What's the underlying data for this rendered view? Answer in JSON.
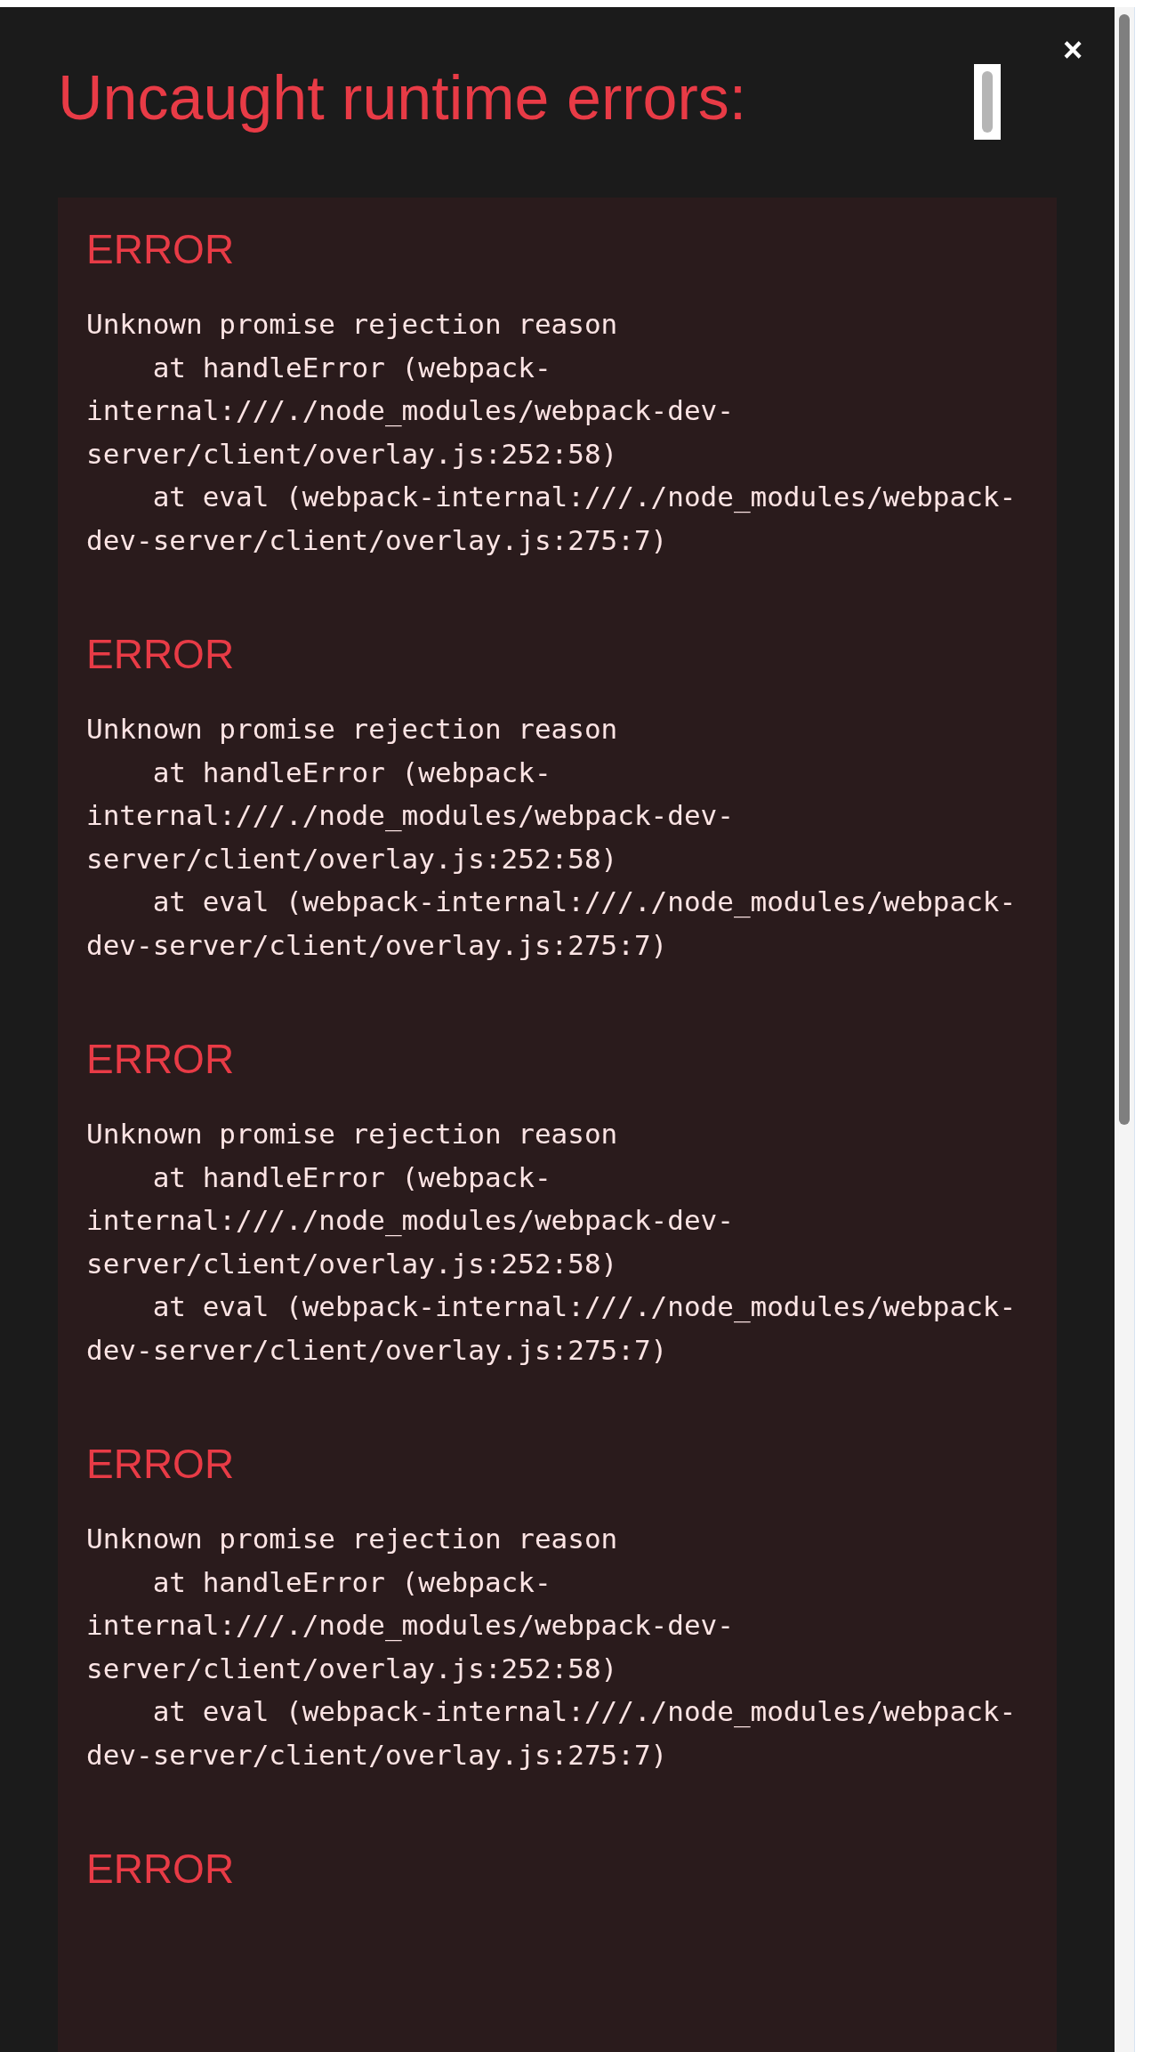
{
  "overlay": {
    "title": "Uncaught runtime errors:",
    "close": "×"
  },
  "errors": [
    {
      "title": "ERROR",
      "message": "Unknown promise rejection reason\n    at handleError (webpack-internal:///./node_modules/webpack-dev-server/client/overlay.js:252:58)\n    at eval (webpack-internal:///./node_modules/webpack-dev-server/client/overlay.js:275:7)"
    },
    {
      "title": "ERROR",
      "message": "Unknown promise rejection reason\n    at handleError (webpack-internal:///./node_modules/webpack-dev-server/client/overlay.js:252:58)\n    at eval (webpack-internal:///./node_modules/webpack-dev-server/client/overlay.js:275:7)"
    },
    {
      "title": "ERROR",
      "message": "Unknown promise rejection reason\n    at handleError (webpack-internal:///./node_modules/webpack-dev-server/client/overlay.js:252:58)\n    at eval (webpack-internal:///./node_modules/webpack-dev-server/client/overlay.js:275:7)"
    },
    {
      "title": "ERROR",
      "message": "Unknown promise rejection reason\n    at handleError (webpack-internal:///./node_modules/webpack-dev-server/client/overlay.js:252:58)\n    at eval (webpack-internal:///./node_modules/webpack-dev-server/client/overlay.js:275:7)"
    },
    {
      "title": "ERROR"
    }
  ]
}
